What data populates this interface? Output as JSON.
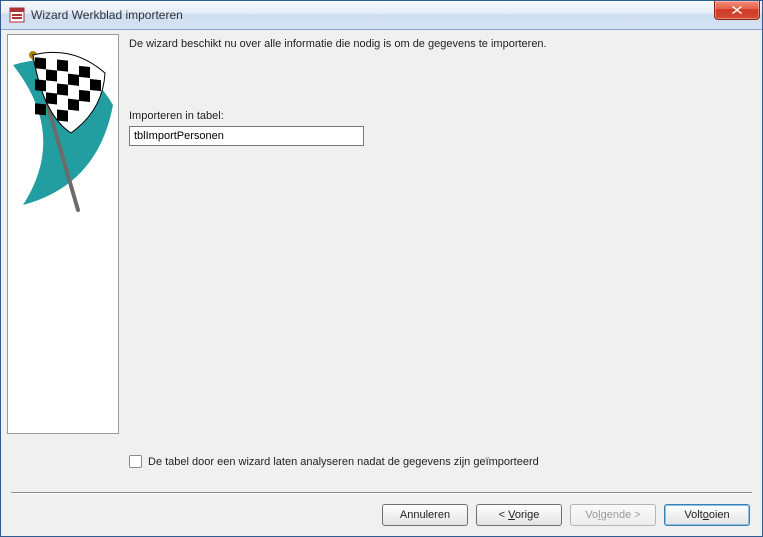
{
  "window": {
    "title": "Wizard Werkblad importeren"
  },
  "content": {
    "intro": "De wizard beschikt nu over alle informatie die nodig is om de gegevens te importeren.",
    "field_label": "Importeren in tabel:",
    "table_name": "tblImportPersonen",
    "analyze_label": "De tabel door een wizard laten analyseren nadat de gegevens zijn geïmporteerd",
    "analyze_checked": false
  },
  "buttons": {
    "cancel": "Annuleren",
    "back_prefix": "< ",
    "back_key": "V",
    "back_suffix": "orige",
    "next_prefix": "Vo",
    "next_key": "l",
    "next_suffix": "gende >",
    "finish_prefix": "Volt",
    "finish_key": "o",
    "finish_suffix": "oien"
  }
}
